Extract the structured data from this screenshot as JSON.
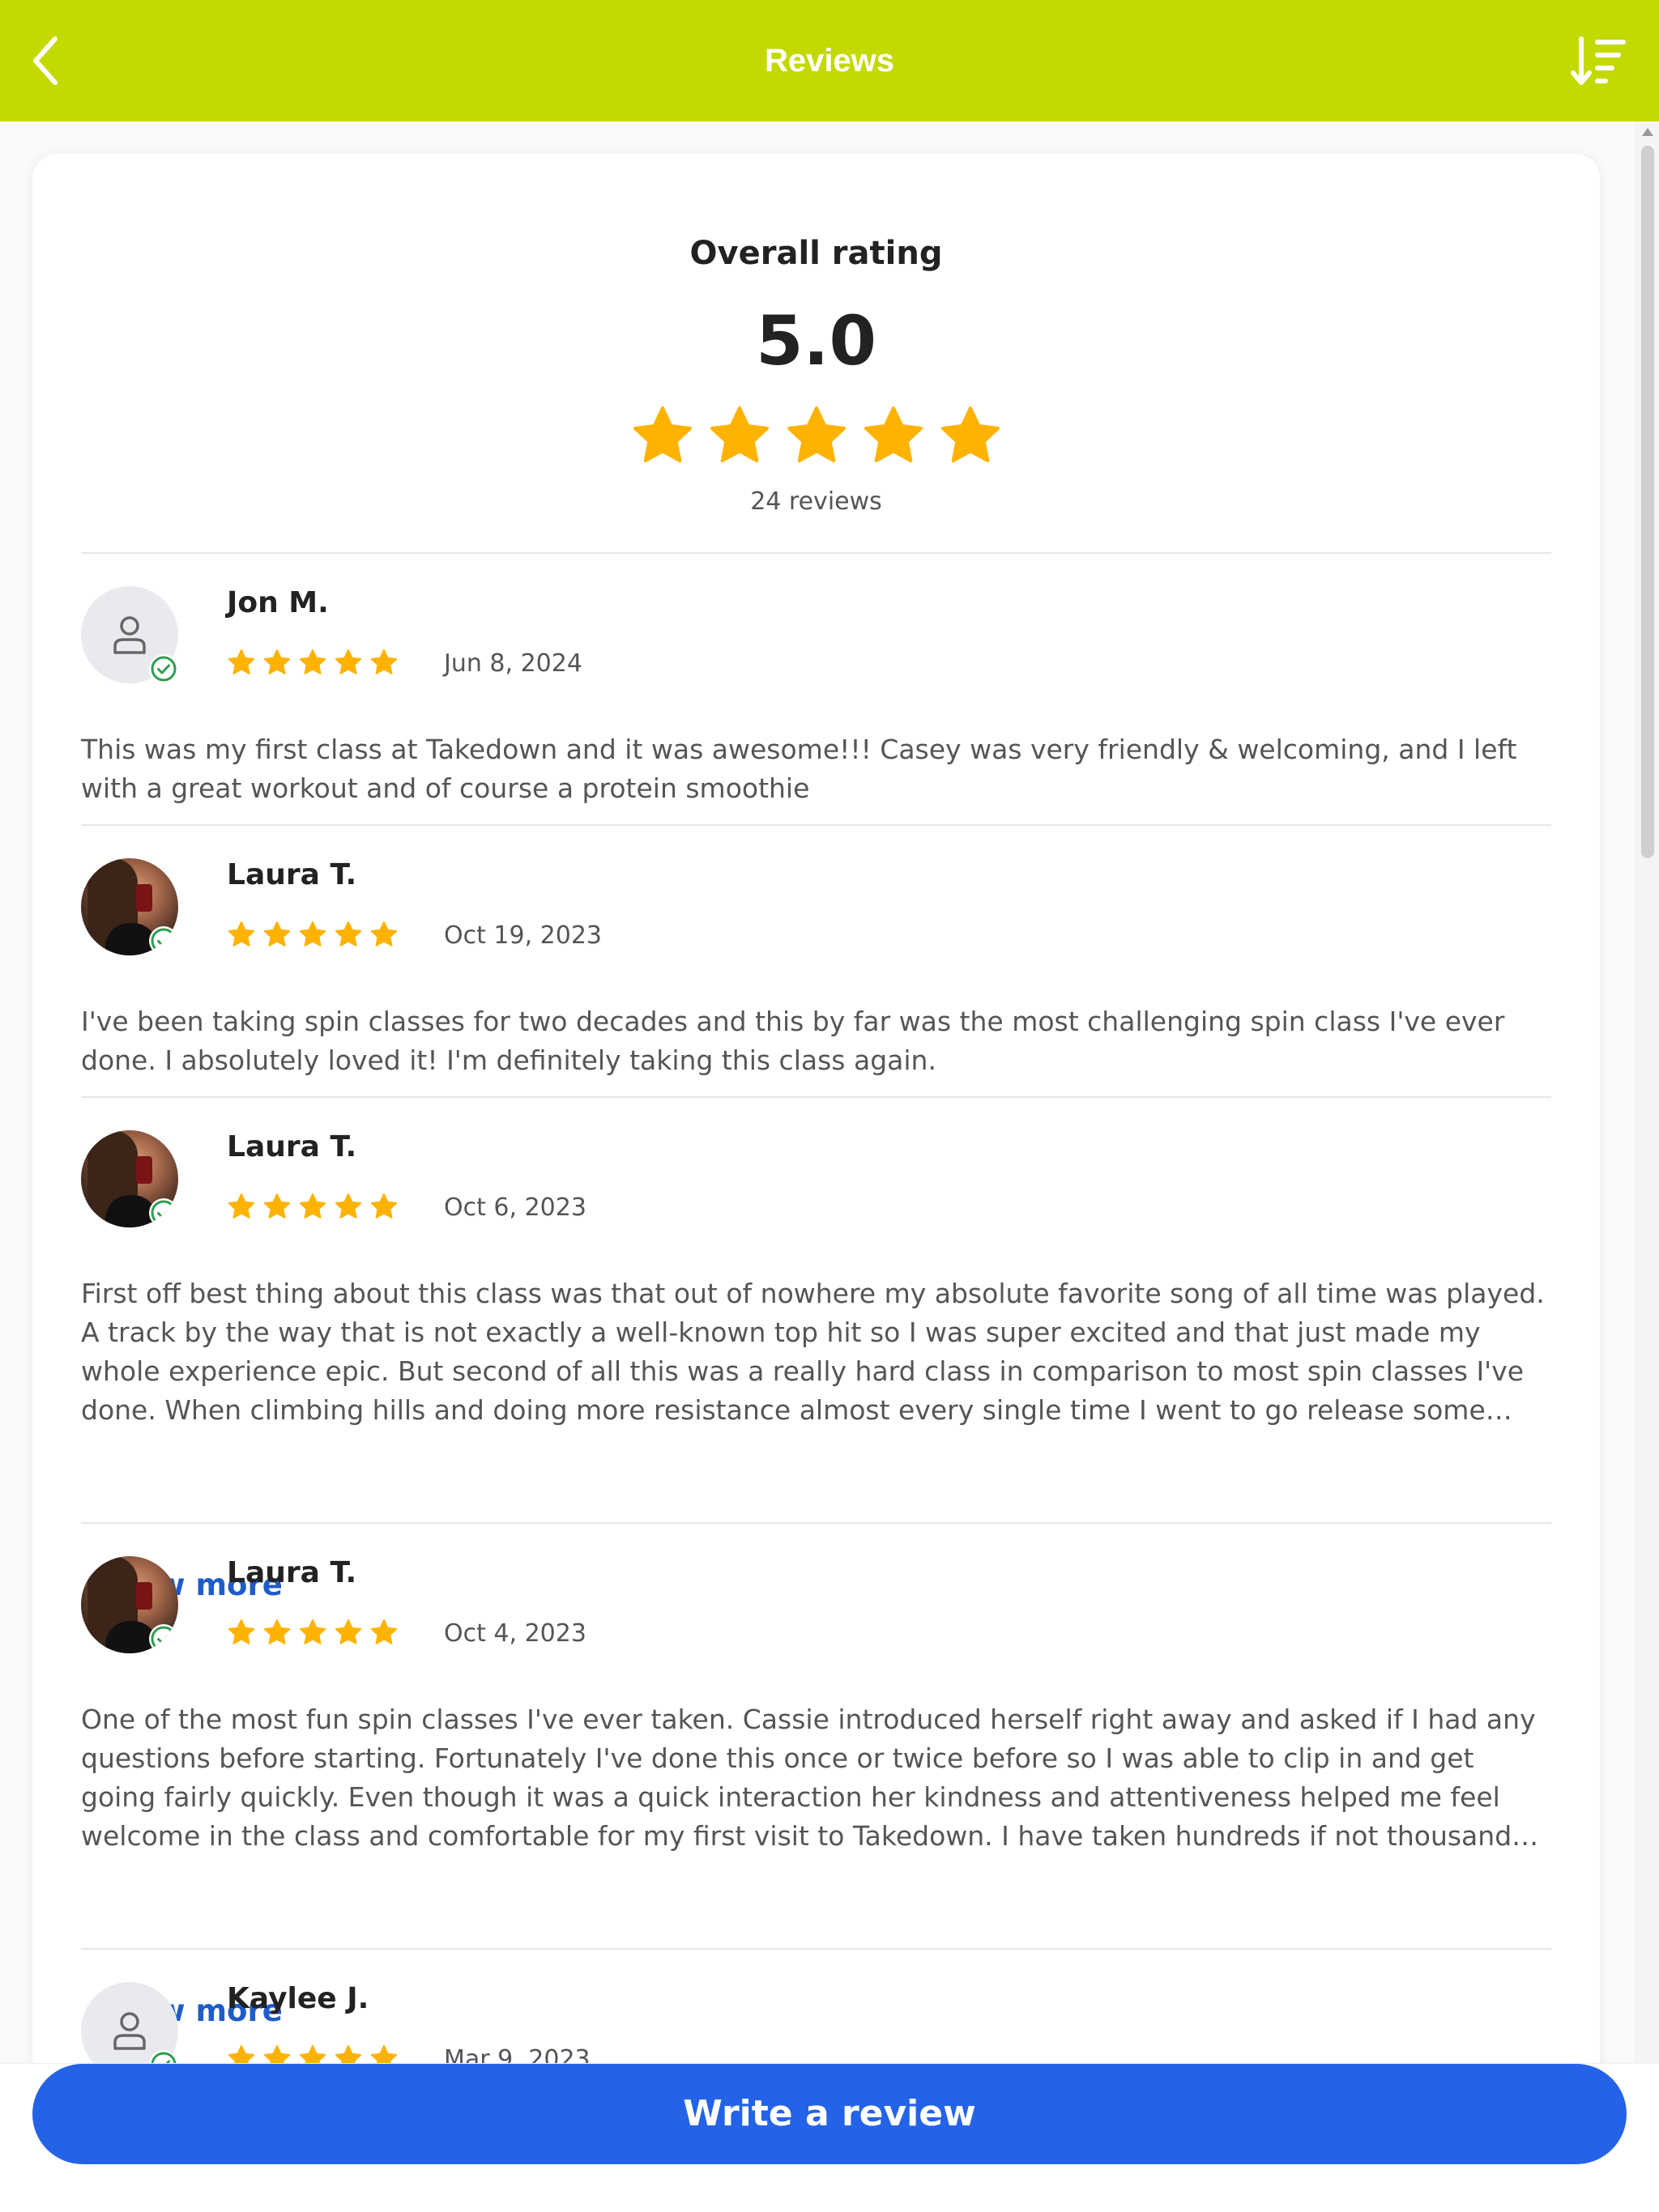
{
  "header": {
    "title": "Reviews",
    "back_icon": "chevron-left-icon",
    "sort_icon": "sort-descending-icon",
    "color": "#c3d900"
  },
  "summary": {
    "title": "Overall rating",
    "score": "5.0",
    "stars": 5,
    "count_label": "24 reviews",
    "star_color": "#ffb300"
  },
  "reviews": [
    {
      "name": "Jon M.",
      "date": "Jun 8, 2024",
      "rating": 5,
      "avatar": "default-person-icon",
      "verified": true,
      "text": "This was my first class at Takedown and it was awesome!!! Casey was very friendly & welcoming, and I left with a great workout and of course a protein smoothie"
    },
    {
      "name": "Laura T.",
      "date": "Oct 19, 2023",
      "rating": 5,
      "avatar": "photo",
      "verified": true,
      "text": "I've been taking spin classes for two decades and this by far was the most challenging spin class I've ever done. I absolutely loved it! I'm definitely taking this class again."
    },
    {
      "name": "Laura T.",
      "date": "Oct 6, 2023",
      "rating": 5,
      "avatar": "photo",
      "verified": true,
      "text": "First off best thing about this class was that out of nowhere my absolute favorite song of all time was played. A track by the way that is not exactly a well-known top hit so I was super excited and that just made my whole experience epic. But second of all this was a really hard class in comparison to most spin classes I've done. When climbing hills and doing more resistance almost every single time I went to go release some tension because my…",
      "show_more": "Show more"
    },
    {
      "name": "Laura T.",
      "date": "Oct 4, 2023",
      "rating": 5,
      "avatar": "photo",
      "verified": true,
      "text": "One of the most fun spin classes I've ever taken. Cassie introduced herself right away and asked if I had any questions before starting. Fortunately I've done this once or twice before so I was able to clip in and get going fairly quickly. Even though it was a quick interaction her kindness and attentiveness helped me feel welcome in the class and comfortable for my first visit to Takedown. I have taken hundreds if not thousands of spin classes and group…",
      "show_more": "Show more"
    },
    {
      "name": "Kaylee J.",
      "date": "Mar 9, 2023",
      "rating": 5,
      "avatar": "default-person-icon",
      "verified": true
    }
  ],
  "footer": {
    "write_review_label": "Write a review",
    "button_color": "#2463e8"
  }
}
